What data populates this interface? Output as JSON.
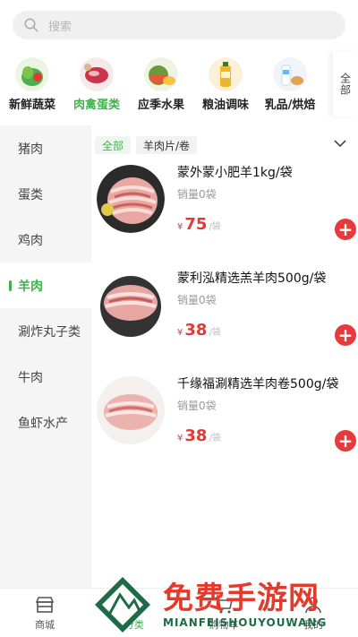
{
  "search": {
    "placeholder": "搜索"
  },
  "categories": [
    {
      "label": "新鲜蔬菜",
      "icon": "vegetables-icon"
    },
    {
      "label": "肉禽蛋类",
      "icon": "meat-icon",
      "active": true
    },
    {
      "label": "应季水果",
      "icon": "fruit-icon"
    },
    {
      "label": "粮油调味",
      "icon": "oil-icon"
    },
    {
      "label": "乳品/烘焙",
      "icon": "dairy-icon"
    }
  ],
  "more_label": "全部",
  "side_nav": [
    {
      "label": "猪肉"
    },
    {
      "label": "蛋类"
    },
    {
      "label": "鸡肉"
    },
    {
      "label": "羊肉",
      "active": true
    },
    {
      "label": "涮炸丸子类"
    },
    {
      "label": "牛肉"
    },
    {
      "label": "鱼虾水产"
    }
  ],
  "filters": [
    {
      "label": "全部",
      "active": true
    },
    {
      "label": "羊肉片/卷"
    }
  ],
  "products": [
    {
      "name": "蒙外蒙小肥羊1kg/袋",
      "sales": "销量0袋",
      "currency": "¥",
      "price": "75",
      "unit": "/袋"
    },
    {
      "name": "蒙利泓精选羔羊肉500g/袋",
      "sales": "销量0袋",
      "currency": "¥",
      "price": "38",
      "unit": "/袋"
    },
    {
      "name": "千缘福涮精选羊肉卷500g/袋",
      "sales": "销量0袋",
      "currency": "¥",
      "price": "38",
      "unit": "/袋"
    }
  ],
  "tabs": [
    {
      "label": "商城",
      "icon": "store-icon"
    },
    {
      "label": "分类",
      "icon": "category-icon",
      "active": true
    },
    {
      "label": "购物车",
      "icon": "cart-icon"
    },
    {
      "label": "我的",
      "icon": "user-icon"
    }
  ],
  "watermark": {
    "title": "免费手游网",
    "subtitle": "MIANFEISHOUYOUWANG"
  },
  "colors": {
    "accent": "#3db24b",
    "price": "#e23a3a",
    "add_button": "#e8393d"
  }
}
